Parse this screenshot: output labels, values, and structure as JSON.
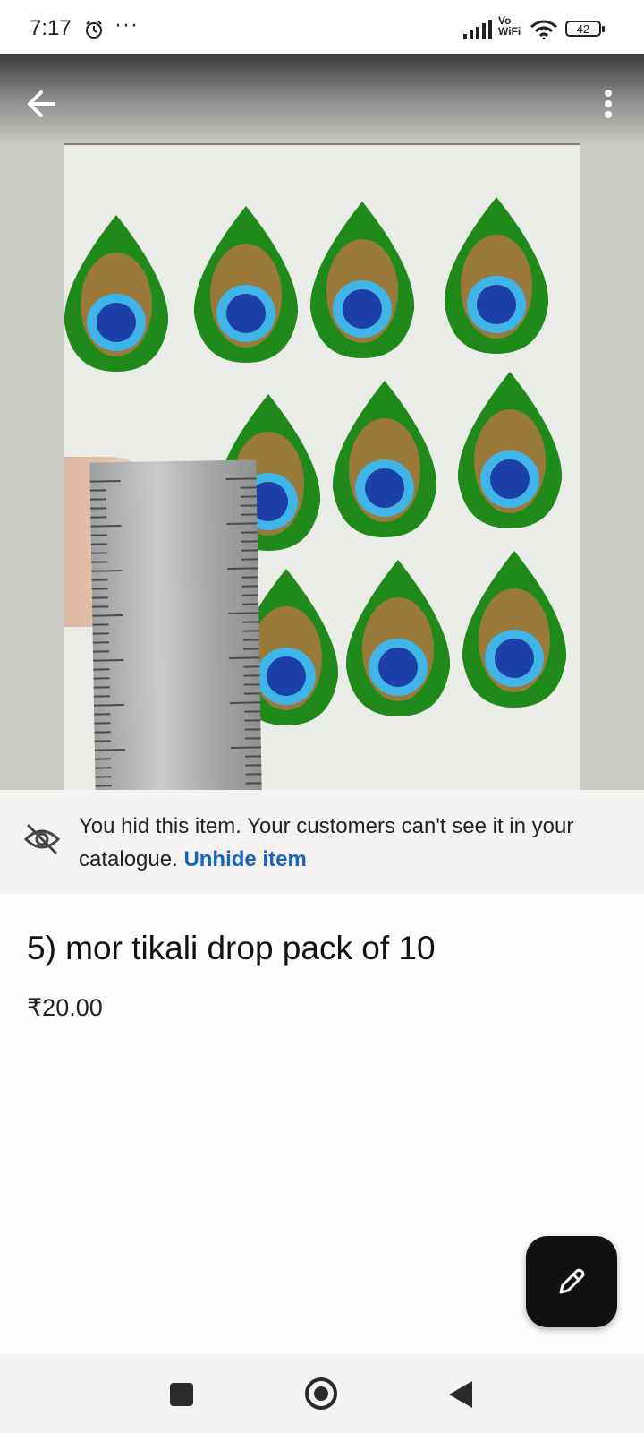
{
  "status_bar": {
    "time": "7:17",
    "more": "···",
    "network": "Vo WiFi",
    "network_line1": "Vo",
    "network_line2": "WiFi",
    "battery": "42"
  },
  "app_bar": {
    "back_icon": "arrow-left-icon",
    "more_icon": "more-vertical-icon"
  },
  "notice": {
    "icon": "eye-off-icon",
    "message": "You hid this item. Your customers can't see it in your catalogue.",
    "action": "Unhide item"
  },
  "product": {
    "title": "5) mor tikali drop pack of 10",
    "price": "₹20.00"
  },
  "fab": {
    "icon": "pencil-icon"
  },
  "nav": {
    "recent_icon": "square-icon",
    "home_icon": "circle-icon",
    "back_icon": "triangle-back-icon"
  },
  "colors": {
    "link": "#1565c0",
    "fab_bg": "#111111",
    "feather_green": "#1f8a1a",
    "feather_blue": "#1d3fa8",
    "feather_cyan": "#3fb4e6",
    "feather_brown": "#9a7a3a"
  }
}
